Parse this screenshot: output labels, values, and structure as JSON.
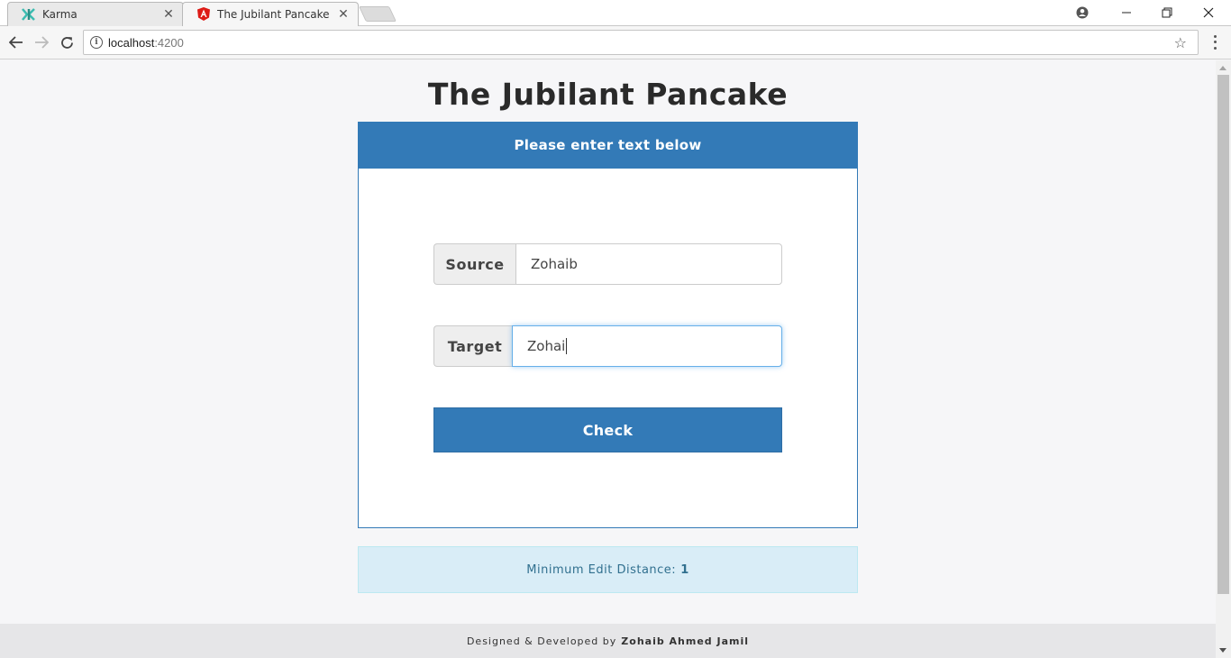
{
  "browser": {
    "tabs": [
      {
        "title": "Karma",
        "icon": "karma-icon",
        "active": false
      },
      {
        "title": "The Jubilant Pancake",
        "icon": "angular-icon",
        "active": true
      }
    ],
    "url_host": "localhost",
    "url_port": ":4200"
  },
  "page": {
    "title": "The Jubilant Pancake",
    "panel_heading": "Please enter text below",
    "source_label": "Source",
    "source_value": "Zohaib",
    "target_label": "Target",
    "target_value": "Zohai",
    "check_label": "Check",
    "result_label": "Minimum Edit Distance:",
    "result_value": "1",
    "footer_prefix": "Designed & Developed by",
    "footer_author": "Zohaib Ahmed Jamil"
  },
  "colors": {
    "primary": "#337ab7",
    "info_bg": "#d9edf7",
    "info_text": "#31708f",
    "angular_red": "#dd1b16",
    "karma_teal": "#3cbcb0"
  }
}
